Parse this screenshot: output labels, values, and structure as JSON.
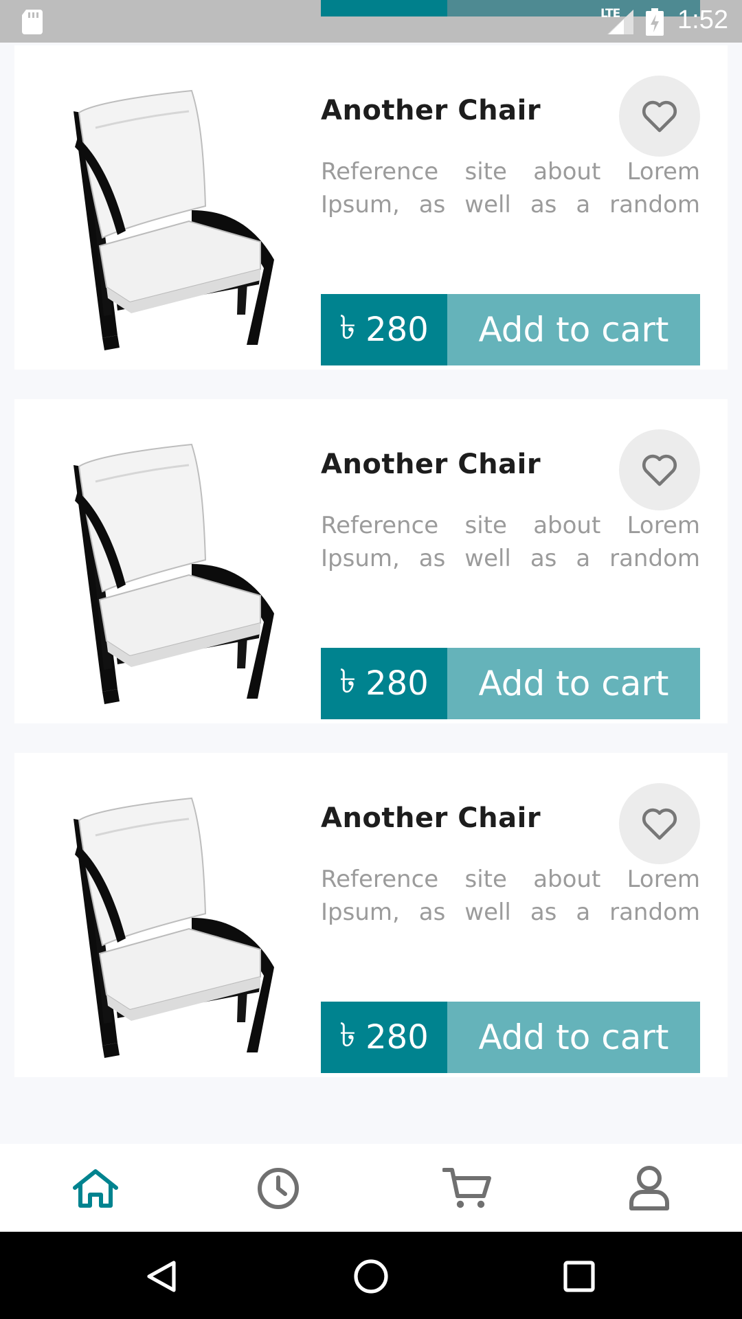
{
  "status_bar": {
    "network": "LTE",
    "time": "1:52"
  },
  "colors": {
    "accent": "#00838f",
    "accent_light": "#65b3ba",
    "nav_active": "#00838f",
    "nav_inactive": "#707070"
  },
  "products": [
    {
      "title": "Another Chair",
      "description": "Reference site about Lorem Ipsum, as well as a random",
      "currency": "৳",
      "price": "280",
      "cart_label": "Add to cart",
      "image": "armchair-image",
      "favorite_icon": "heart-outline-icon"
    },
    {
      "title": "Another Chair",
      "description": "Reference site about Lorem Ipsum, as well as a random",
      "currency": "৳",
      "price": "280",
      "cart_label": "Add to cart",
      "image": "armchair-image",
      "favorite_icon": "heart-outline-icon"
    },
    {
      "title": "Another Chair",
      "description": "Reference site about Lorem Ipsum, as well as a random",
      "currency": "৳",
      "price": "280",
      "cart_label": "Add to cart",
      "image": "armchair-image",
      "favorite_icon": "heart-outline-icon"
    }
  ],
  "bottom_nav": {
    "items": [
      {
        "icon": "home-icon",
        "active": true
      },
      {
        "icon": "clock-icon",
        "active": false
      },
      {
        "icon": "cart-icon",
        "active": false
      },
      {
        "icon": "user-icon",
        "active": false
      }
    ]
  },
  "system_nav": {
    "buttons": [
      "back-icon",
      "home-circle-icon",
      "recents-icon"
    ]
  }
}
